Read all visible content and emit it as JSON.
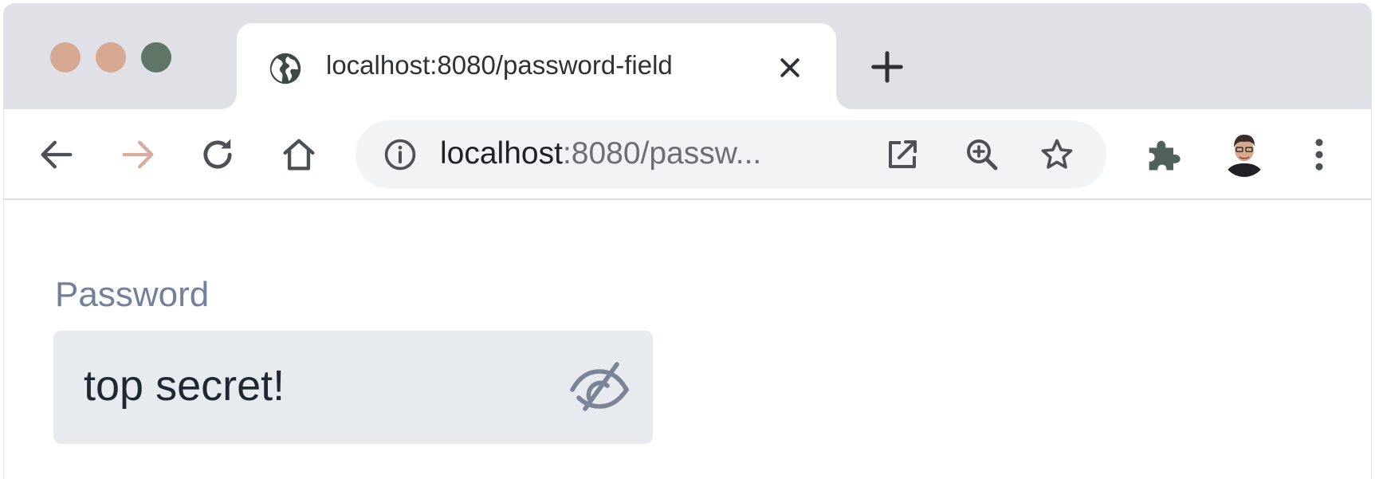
{
  "browser": {
    "tab": {
      "title": "localhost:8080/password-field",
      "favicon": "globe-icon"
    },
    "address_bar": {
      "host": "localhost",
      "rest": ":8080/passw..."
    },
    "icons": {
      "back": "arrow-left-icon",
      "forward": "arrow-right-icon",
      "reload": "reload-icon",
      "home": "home-icon",
      "site_info": "info-icon",
      "open_in_new": "open-external-icon",
      "zoom": "zoom-in-icon",
      "bookmark": "star-icon",
      "extensions": "puzzle-icon",
      "profile": "avatar",
      "menu": "more-vertical-icon",
      "new_tab": "plus-icon",
      "close_tab": "close-icon"
    },
    "colors": {
      "traffic_close": "#d6a891",
      "traffic_minimize": "#d6a891",
      "traffic_maximize": "#5f7565",
      "titlebar": "#dfe1e6",
      "forward_arrow_disabled": "#d9aca0"
    }
  },
  "page": {
    "password": {
      "label": "Password",
      "value": "top secret!",
      "visibility_toggle": "eye-slash-icon"
    },
    "colors": {
      "label": "#72809e",
      "field_bg": "#e7eaee",
      "text": "#1f2733"
    }
  }
}
